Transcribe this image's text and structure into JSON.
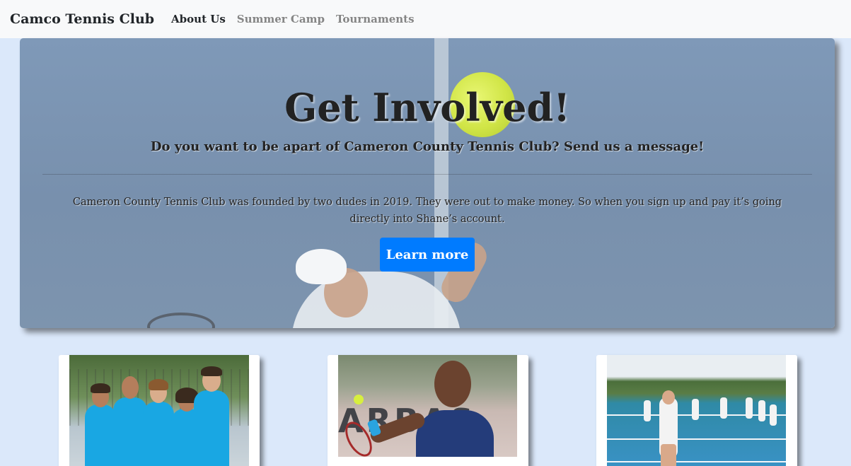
{
  "navbar": {
    "brand": "Camco Tennis Club",
    "links": [
      {
        "label": "About Us",
        "active": true
      },
      {
        "label": "Summer Camp",
        "active": false
      },
      {
        "label": "Tournaments",
        "active": false
      }
    ]
  },
  "hero": {
    "title": "Get Involved!",
    "subtitle": "Do you want to be apart of Cameron County Tennis Club? Send us a message!",
    "body": "Cameron County Tennis Club was founded by two dudes in 2019. They were out to make money. So when you sign up and pay it’s going directly into Shane’s account.",
    "button_label": "Learn more"
  },
  "cards": [
    {
      "image": "team-photo"
    },
    {
      "image": "player-photo"
    },
    {
      "image": "courts-photo"
    }
  ],
  "colors": {
    "accent": "#007bff",
    "page_background": "#dbe8fa",
    "navbar_background": "#f8f9fa"
  }
}
